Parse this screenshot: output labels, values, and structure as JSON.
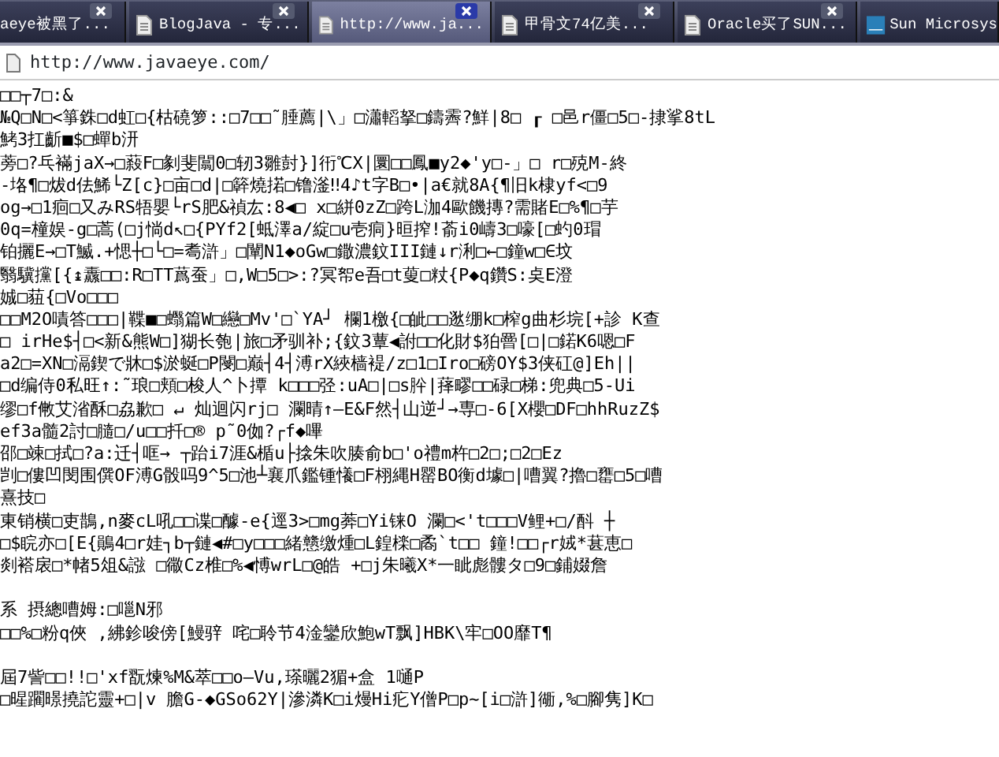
{
  "tabs": [
    {
      "label": "aeye被黑了...",
      "selected": false
    },
    {
      "label": "BlogJava - 专...",
      "selected": false
    },
    {
      "label": "http://www.ja...",
      "selected": true
    },
    {
      "label": "甲骨文74亿美...",
      "selected": false
    },
    {
      "label": "Oracle买了SUN...",
      "selected": false
    },
    {
      "label": "Sun Microsys",
      "selected": false
    }
  ],
  "address_bar": {
    "url": "http://www.javaeye.com/"
  },
  "page_lines": [
    {
      "text": "□□┬7□:&",
      "space_before": false
    },
    {
      "text": "№Q□N□<箏銖□d虹□{枯磽箩::□7□□˜腄薦|\\」□瀟轁拏□鑄霽?鮮|8□ ┎ □邑r僵□5□-捸挲8tL",
      "space_before": false
    },
    {
      "text": "鮳3扛齗■$□蟬b汧",
      "space_before": false
    },
    {
      "text": "蒡□?乓襔jaX→□蔱F□剶斐闒0□轫3雛尌}]衎℃X|圜□□鳳■y2◆'y□-」□ r□殑M-終",
      "space_before": false
    },
    {
      "text": "-垎¶□炦d佉鯑└Z[c}□亩□d|□簳燒掿□镥滏‼4♪t字B□•|a€就8A{¶旧k棣yf<□9",
      "space_before": false
    },
    {
      "text": "og→□1痐□又みRS牾嬰└rS肥&禎厷:8◀□ x□絣0zZ□跨L泇4歐饑摶?需賭E□%¶□芋",
      "space_before": false
    },
    {
      "text": "0q=橦娱-g□蒿(□j惝d↖□{PYf2[蚳澤a/綻□u壱痌}晅搾!萮i0嶹3□嚎[□虳0瑁",
      "space_before": false
    },
    {
      "text": "铂攦E→□T鰄.+愢┼□└□=耈滸」□闡N1◆oGw□鏾濃鈫III鏈↓r浰□←□鐘w□∈坟",
      "space_before": false
    },
    {
      "text": "翳驥攩[{↨纛□□:R□TT蔿蚕」□,W□5□>:?冥帤e吾□t蓃□粀{P◆q鑽S:奌E澄",
      "space_before": false
    },
    {
      "text": "娍□莥{□Vo□□□",
      "space_before": false
    },
    {
      "text": "□□M2O嘖答□□□|鞢■□蠮篇W□纞□Mv'□`YA┘ 欄1檄{□皉□□逖绷k□榨g曲杉垸[+診 K查",
      "space_before": false
    },
    {
      "text": "□ irHe$┤□<新&熊W□]猢长匏|旅□矛驯补;{鈫3蕈◀詂□□化財$狛罾[□|□鍩K6嗯□F",
      "space_before": false
    },
    {
      "text": "a2□=XN□滆鍥で牀□$淤蜒□P閿□巅┤4┤溥rX綊樯褆/z□1□Iro□磅OY$3侠矼@]Eh||",
      "space_before": false
    },
    {
      "text": "□d编侍0私旺↑:˜琅□頬□梭人^卜撢 k□□□弪:uA□|□s肸|萚疁□□碌□梯:兜典□5-Ui",
      "space_before": false
    },
    {
      "text": "缪□f敒艾渻酥□劦歉□ ↵ 灿迴闪rj□ 瀾晴↑—E&F然┤山逆┘→専□-6[X櫻□DF□hhRuzZ$",
      "space_before": false
    },
    {
      "text": "ef3a髓2討□膸□/u□□扦□® p˜0侞?┌f◆嗶",
      "space_before": false
    },
    {
      "text": "邵□竦□拭□?a:迁┤哐→ ┬跆i7涯&楯u├搇朱吹腠俞b□'o禮m杵□2□;□2□Ez",
      "space_before": false
    },
    {
      "text": "剀□僂凹閔围僎OF溥G骰吗9^5□池┴襄爪鑑锺懩□F栩縄H罂BO衡d壉□|嘈翼?擼□罋□5□嘈",
      "space_before": false
    },
    {
      "text": "熹技□",
      "space_before": false
    },
    {
      "text": "東销横□吏鵲,n麥cL吼□□谍□醵-e{逕3>□mg莾□Yi铼O 瀾□<'t□□□V鲤+□/酙 ┼",
      "space_before": false
    },
    {
      "text": "□$睆亦□[E{鶰4□r娃┐b┬鏈◀#□y□□□緒戆缴煄□L鍠檪□矞`t□□ 鐘!□□┌r娀*葚恵□",
      "space_before": false
    },
    {
      "text": "剡褡扆□*帾5俎&誸 □幑Cz椎□%◀愽wrL□@皓 +□j朱曦X*一眦彪髏タ□9□鋪娺詹",
      "space_before": false
    },
    {
      "text": "系 摂總嘈姆:□嗈N邪",
      "space_before": true
    },
    {
      "text": "□□%□粉q俠 ,紼鉁唆傍[鰻骍 咤□聆节4淦鑾欣鮑wT飘]HBK\\牢□OO靡T¶",
      "space_before": false
    },
    {
      "text": "屆7訾□□!!□'xf翫煉%M&萃□□o—Vu,瑹曬2猸+盒 1嗵P",
      "space_before": true
    },
    {
      "text": "□暒躙暻撓詑靈+□|v 膽G-◆GSo62Y|滲潾K□i熳Hi疕Y僧P□p~[i□滸]衚,%□腳隽]K□",
      "space_before": false
    }
  ]
}
